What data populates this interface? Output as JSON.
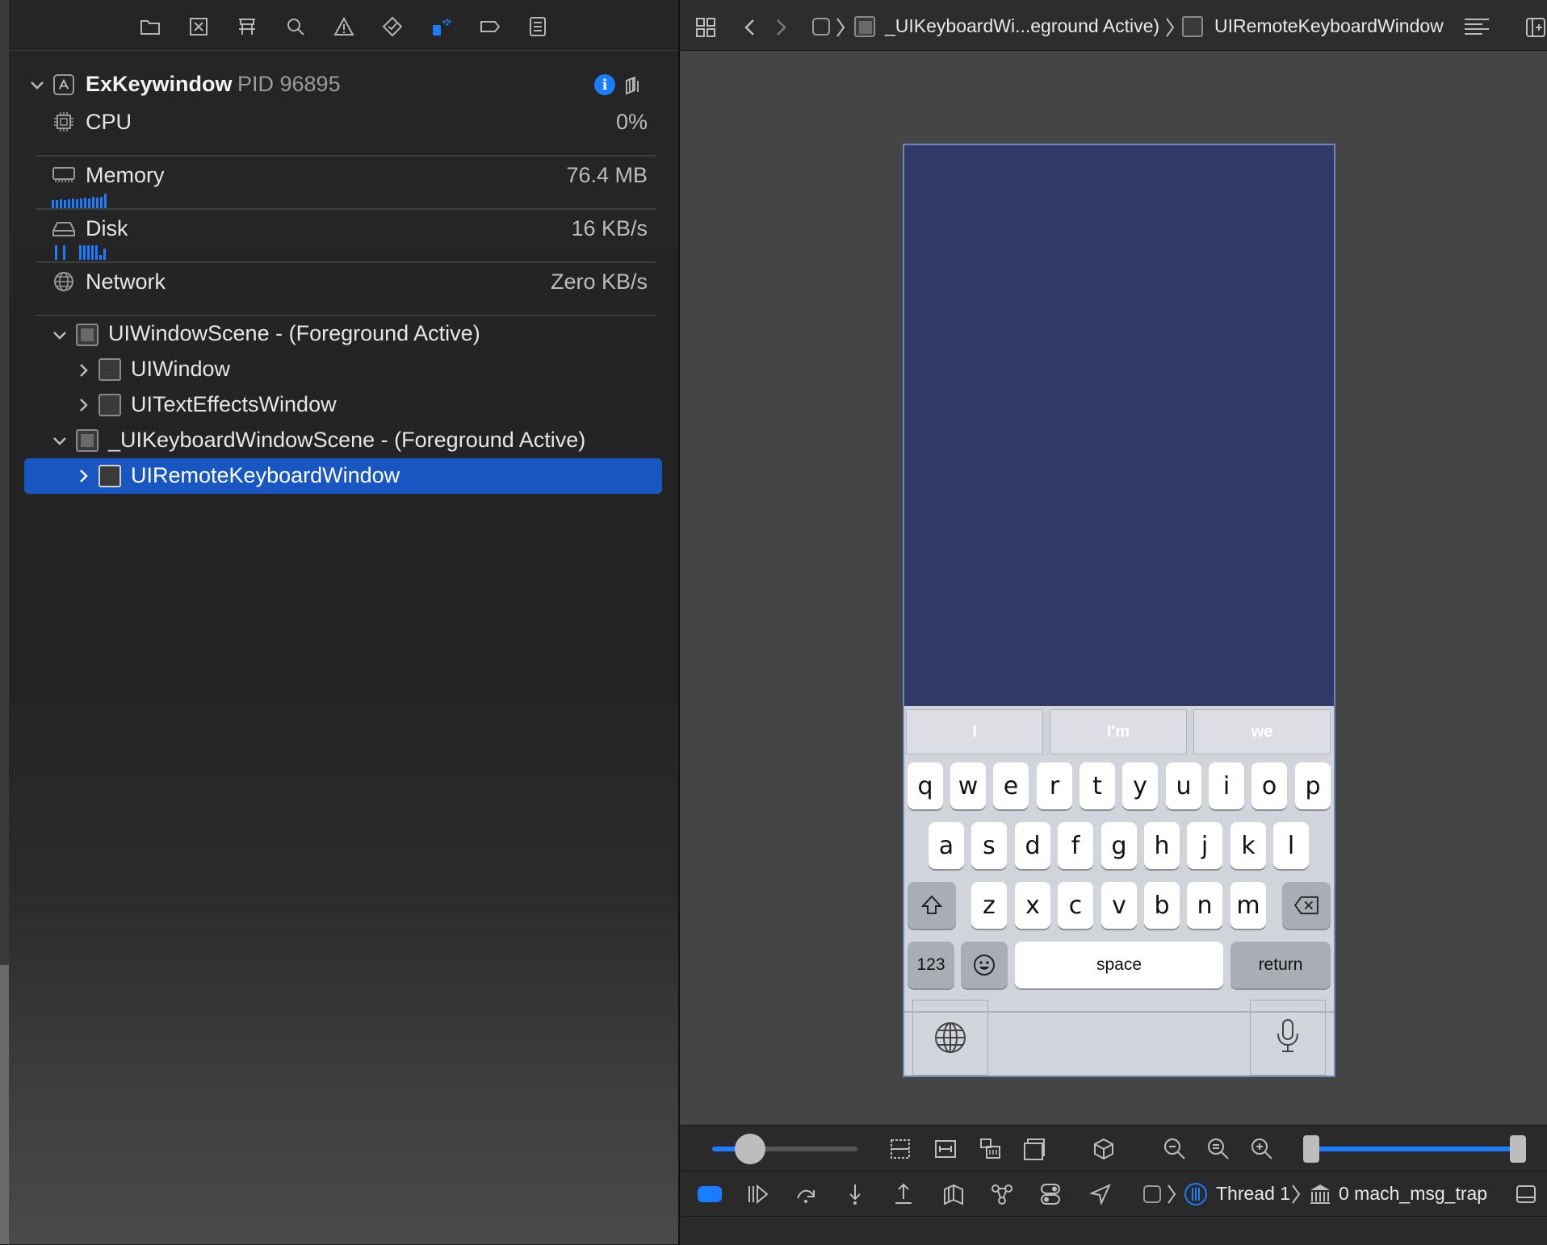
{
  "process": {
    "name": "ExKeywindow",
    "pid": "PID 96895"
  },
  "gauges": [
    {
      "label": "CPU",
      "value": "0%"
    },
    {
      "label": "Memory",
      "value": "76.4 MB"
    },
    {
      "label": "Disk",
      "value": "16 KB/s"
    },
    {
      "label": "Network",
      "value": "Zero KB/s"
    }
  ],
  "tree": {
    "scene1": "UIWindowScene - (Foreground Active)",
    "window1": "UIWindow",
    "window2": "UITextEffectsWindow",
    "scene2": "_UIKeyboardWindowScene - (Foreground Active)",
    "window3": "UIRemoteKeyboardWindow"
  },
  "jumpbar": {
    "crumb1": "_UIKeyboardWi...eground Active)",
    "crumb2": "UIRemoteKeyboardWindow"
  },
  "keyboard": {
    "suggestions": [
      "I",
      "I'm",
      "we"
    ],
    "row1": [
      "q",
      "w",
      "e",
      "r",
      "t",
      "y",
      "u",
      "i",
      "o",
      "p"
    ],
    "row2": [
      "a",
      "s",
      "d",
      "f",
      "g",
      "h",
      "j",
      "k",
      "l"
    ],
    "row3": [
      "z",
      "x",
      "c",
      "v",
      "b",
      "n",
      "m"
    ],
    "numbers": "123",
    "space": "space",
    "return": "return"
  },
  "debug": {
    "thread": "Thread 1",
    "frame": "0 mach_msg_trap"
  },
  "colors": {
    "accent": "#1857c2",
    "device_bg": "#313966"
  }
}
